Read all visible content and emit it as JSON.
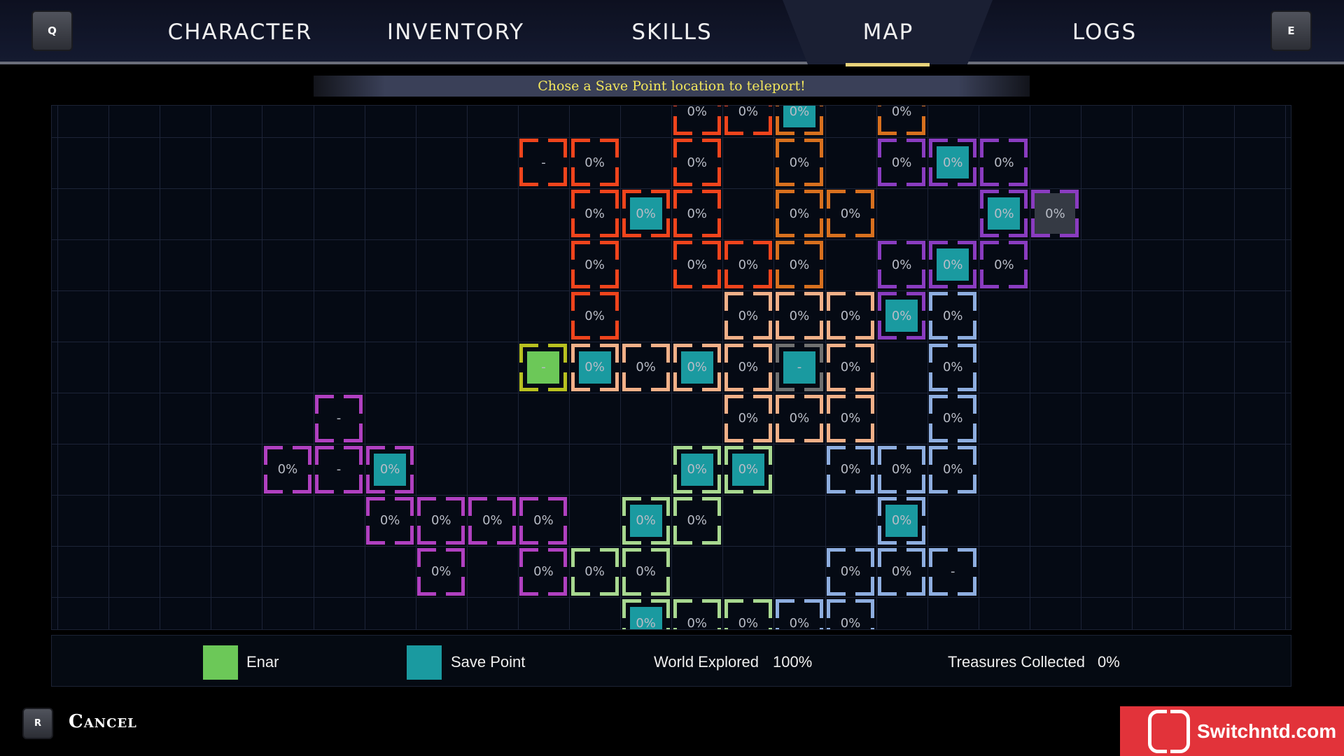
{
  "header": {
    "left_key": "Q",
    "right_key": "E",
    "tabs": [
      {
        "label": "CHARACTER"
      },
      {
        "label": "INVENTORY"
      },
      {
        "label": "SKILLS"
      },
      {
        "label": "MAP",
        "active": true
      },
      {
        "label": "LOGS"
      }
    ]
  },
  "banner": "Chose a Save Point location to teleport!",
  "colors": {
    "red": "#f0441c",
    "orange": "#d8701e",
    "purple": "#8a3cc0",
    "peach": "#f2b088",
    "blue": "#8eaee0",
    "magenta": "#b040c0",
    "lightgreen": "#a8d890",
    "enar": "#b8c020",
    "grey": "#707070",
    "save": "#1a9aa0",
    "enar_fill": "#6cc858"
  },
  "rooms": [
    [
      0,
      12,
      "red",
      "0%",
      0
    ],
    [
      0,
      13,
      "red",
      "0%",
      0
    ],
    [
      0,
      14,
      "orange",
      "0%",
      1
    ],
    [
      0,
      16,
      "orange",
      "0%",
      0
    ],
    [
      1,
      9,
      "red",
      "-",
      0
    ],
    [
      1,
      10,
      "red",
      "0%",
      0
    ],
    [
      1,
      12,
      "red",
      "0%",
      0
    ],
    [
      1,
      14,
      "orange",
      "0%",
      0
    ],
    [
      1,
      16,
      "purple",
      "0%",
      0
    ],
    [
      1,
      17,
      "purple",
      "0%",
      1
    ],
    [
      1,
      18,
      "purple",
      "0%",
      0
    ],
    [
      2,
      10,
      "red",
      "0%",
      0
    ],
    [
      2,
      11,
      "red",
      "0%",
      1
    ],
    [
      2,
      12,
      "red",
      "0%",
      0
    ],
    [
      2,
      14,
      "orange",
      "0%",
      0
    ],
    [
      2,
      15,
      "orange",
      "0%",
      0
    ],
    [
      2,
      18,
      "purple",
      "0%",
      1
    ],
    [
      2,
      19,
      "purple",
      "0%",
      2
    ],
    [
      3,
      10,
      "red",
      "0%",
      0
    ],
    [
      3,
      12,
      "red",
      "0%",
      0
    ],
    [
      3,
      13,
      "red",
      "0%",
      0
    ],
    [
      3,
      14,
      "orange",
      "0%",
      0
    ],
    [
      3,
      16,
      "purple",
      "0%",
      0
    ],
    [
      3,
      17,
      "purple",
      "0%",
      1
    ],
    [
      3,
      18,
      "purple",
      "0%",
      0
    ],
    [
      4,
      10,
      "red",
      "0%",
      0
    ],
    [
      4,
      13,
      "peach",
      "0%",
      0
    ],
    [
      4,
      14,
      "peach",
      "0%",
      0
    ],
    [
      4,
      15,
      "peach",
      "0%",
      0
    ],
    [
      4,
      16,
      "purple",
      "0%",
      1
    ],
    [
      4,
      17,
      "blue",
      "0%",
      0
    ],
    [
      5,
      9,
      "enar",
      "-",
      3
    ],
    [
      5,
      10,
      "peach",
      "0%",
      1
    ],
    [
      5,
      11,
      "peach",
      "0%",
      0
    ],
    [
      5,
      12,
      "peach",
      "0%",
      1
    ],
    [
      5,
      13,
      "peach",
      "0%",
      0
    ],
    [
      5,
      14,
      "grey",
      "-",
      1
    ],
    [
      5,
      15,
      "peach",
      "0%",
      0
    ],
    [
      5,
      17,
      "blue",
      "0%",
      0
    ],
    [
      6,
      5,
      "magenta",
      "-",
      0
    ],
    [
      6,
      13,
      "peach",
      "0%",
      0
    ],
    [
      6,
      14,
      "peach",
      "0%",
      0
    ],
    [
      6,
      15,
      "peach",
      "0%",
      0
    ],
    [
      6,
      17,
      "blue",
      "0%",
      0
    ],
    [
      7,
      4,
      "magenta",
      "0%",
      0
    ],
    [
      7,
      5,
      "magenta",
      "-",
      0
    ],
    [
      7,
      6,
      "magenta",
      "0%",
      1
    ],
    [
      7,
      12,
      "lightgreen",
      "0%",
      1
    ],
    [
      7,
      13,
      "lightgreen",
      "0%",
      1
    ],
    [
      7,
      15,
      "blue",
      "0%",
      0
    ],
    [
      7,
      16,
      "blue",
      "0%",
      0
    ],
    [
      7,
      17,
      "blue",
      "0%",
      0
    ],
    [
      8,
      6,
      "magenta",
      "0%",
      0
    ],
    [
      8,
      7,
      "magenta",
      "0%",
      0
    ],
    [
      8,
      8,
      "magenta",
      "0%",
      0
    ],
    [
      8,
      9,
      "magenta",
      "0%",
      0
    ],
    [
      8,
      11,
      "lightgreen",
      "0%",
      1
    ],
    [
      8,
      12,
      "lightgreen",
      "0%",
      0
    ],
    [
      8,
      16,
      "blue",
      "0%",
      1
    ],
    [
      9,
      7,
      "magenta",
      "0%",
      0
    ],
    [
      9,
      9,
      "magenta",
      "0%",
      0
    ],
    [
      9,
      10,
      "lightgreen",
      "0%",
      0
    ],
    [
      9,
      11,
      "lightgreen",
      "0%",
      0
    ],
    [
      9,
      15,
      "blue",
      "0%",
      0
    ],
    [
      9,
      16,
      "blue",
      "0%",
      0
    ],
    [
      9,
      17,
      "blue",
      "-",
      0
    ],
    [
      10,
      11,
      "lightgreen",
      "0%",
      1
    ],
    [
      10,
      12,
      "lightgreen",
      "0%",
      0
    ],
    [
      10,
      13,
      "lightgreen",
      "0%",
      0
    ],
    [
      10,
      14,
      "blue",
      "0%",
      0
    ],
    [
      10,
      15,
      "blue",
      "0%",
      0
    ]
  ],
  "legend": {
    "enar_label": "Enar",
    "save_label": "Save Point",
    "world_label": "World Explored",
    "world_value": "100%",
    "treasure_label": "Treasures Collected",
    "treasure_value": "0%"
  },
  "footer": {
    "cancel_key": "R",
    "cancel_label": "Cancel"
  },
  "watermark": "Switchntd.com"
}
